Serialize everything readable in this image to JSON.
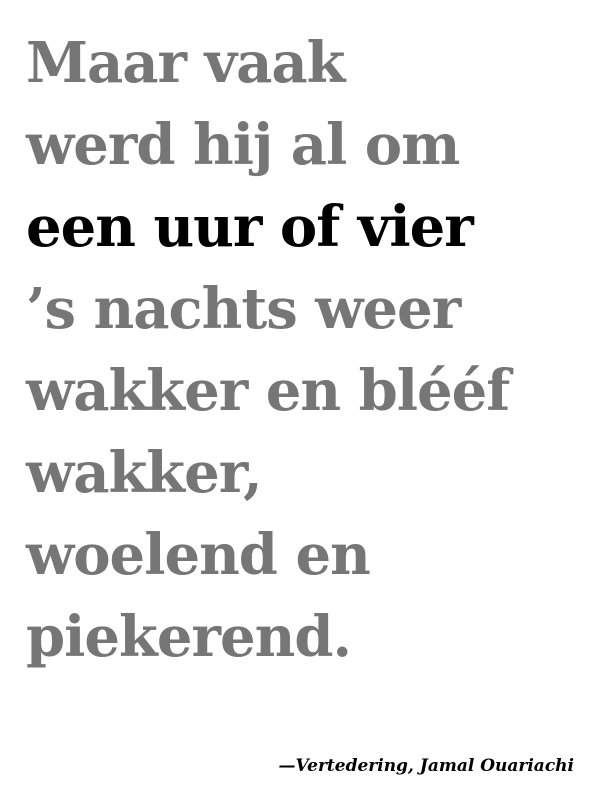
{
  "quote": {
    "lines": [
      "Maar vaak",
      "werd hij al om",
      "een uur of vier",
      "’s nachts weer",
      "wakker en blééf",
      "wakker,",
      "woelend en",
      "piekerend."
    ],
    "highlighted_line_index": 2
  },
  "attribution": "—Vertedering, Jamal Ouariachi",
  "colors": {
    "background": "#ffffff",
    "muted_text": "#767676",
    "highlight_text": "#000000"
  }
}
